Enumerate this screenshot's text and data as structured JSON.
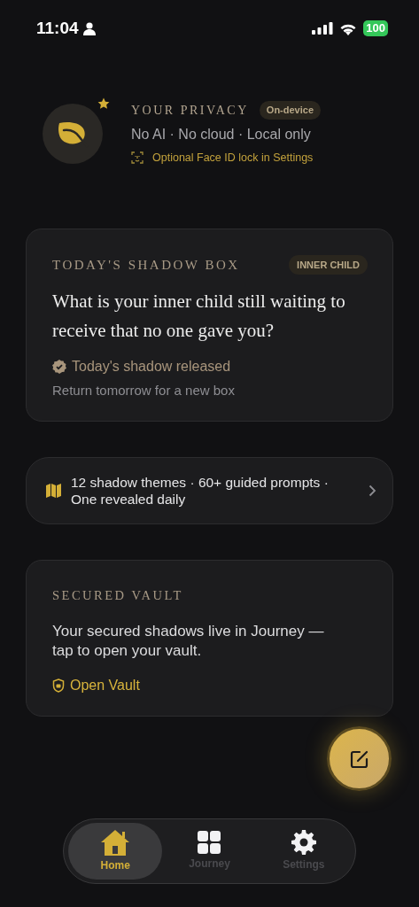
{
  "status_bar": {
    "time": "11:04",
    "battery": "100"
  },
  "privacy": {
    "title": "YOUR PRIVACY",
    "badge": "On-device",
    "summary": "No AI · No cloud · Local only",
    "note": "Optional Face ID lock in Settings"
  },
  "shadow_box": {
    "title": "TODAY'S SHADOW BOX",
    "tag": "INNER CHILD",
    "question": "What is your inner child still waiting to receive that no one gave you?",
    "status": "Today's shadow released",
    "hint": "Return tomorrow for a new box"
  },
  "themes_banner": {
    "text": "12 shadow themes · 60+ guided prompts · One revealed daily"
  },
  "vault": {
    "title": "SECURED VAULT",
    "text": "Your secured shadows live in Journey — tap to open your vault.",
    "link": "Open Vault"
  },
  "tabs": [
    {
      "kind": "home",
      "label": "Home",
      "selected": true
    },
    {
      "kind": "journey",
      "label": "Journey",
      "selected": false
    },
    {
      "kind": "settings",
      "label": "Settings",
      "selected": false
    }
  ]
}
